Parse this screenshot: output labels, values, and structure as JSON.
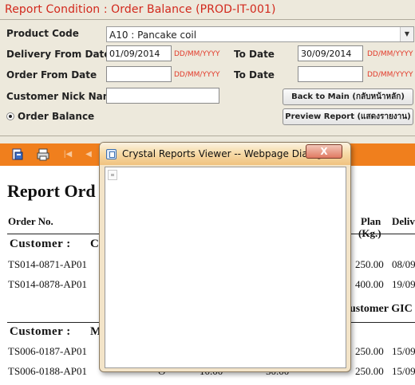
{
  "form": {
    "title": "Report Condition : Order Balance (PROD-IT-001)",
    "product_code_label": "Product Code",
    "product_code_value": "A10 : Pancake coil",
    "delivery_from_label": "Delivery From Date",
    "delivery_from_value": "01/09/2014",
    "delivery_to_label": "To Date",
    "delivery_to_value": "30/09/2014",
    "order_from_label": "Order From Date",
    "order_from_value": "",
    "order_to_label": "To Date",
    "order_to_value": "",
    "date_format_hint": "DD/MM/YYYY",
    "customer_nick_label": "Customer Nick Name",
    "customer_nick_value": "",
    "order_balance_label": "Order Balance",
    "back_button": "Back to Main (กลับหน้าหลัก)",
    "preview_button": "Preview Report (แสดงรายงาน)"
  },
  "toolbar": {
    "icons": [
      "export-icon",
      "print-icon",
      "first-page-icon",
      "previous-page-icon"
    ],
    "accent_color": "#f07f1d"
  },
  "report": {
    "title": "Report Ord",
    "col_order_no": "Order No.",
    "col_plan": "Plan",
    "col_plan_unit": "(Kg.)",
    "col_delivery": "Deliv",
    "group1_label": "Customer  :",
    "group1_name": "C",
    "group2_label": "Customer  :",
    "group2_name": "M",
    "group_footer": "ustomer GIC",
    "rows": [
      {
        "order": "TS014-0871-AP01",
        "plan": "250.00",
        "delivery": "08/09"
      },
      {
        "order": "TS014-0878-AP01",
        "plan": "400.00",
        "delivery": "19/09"
      },
      {
        "order": "TS006-0187-AP01",
        "plan": "250.00",
        "delivery": "15/09"
      },
      {
        "order": "TS006-0188-AP01",
        "plan": "250.00",
        "delivery": "15/09"
      }
    ],
    "partial_cells": [
      "O",
      "10.00",
      "50.00"
    ]
  },
  "dialog": {
    "title": "Crystal Reports Viewer -- Webpage Dialog",
    "close_glyph": "X"
  }
}
